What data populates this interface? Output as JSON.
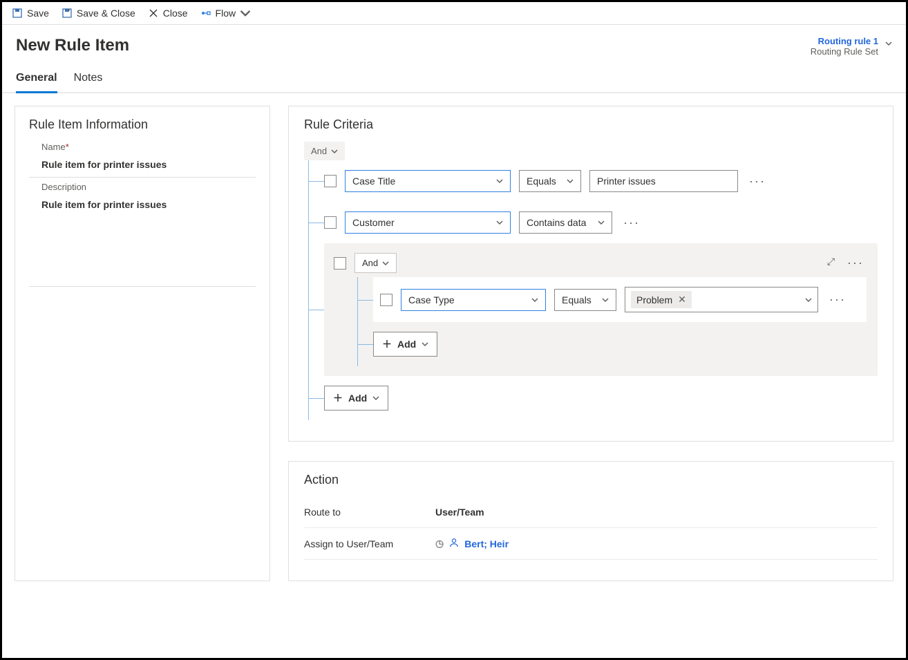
{
  "toolbar": {
    "save": "Save",
    "save_close": "Save & Close",
    "close": "Close",
    "flow": "Flow"
  },
  "header": {
    "title": "New Rule Item",
    "context_link": "Routing rule 1",
    "context_sub": "Routing Rule Set"
  },
  "tabs": {
    "general": "General",
    "notes": "Notes"
  },
  "info": {
    "section": "Rule Item Information",
    "name_label": "Name",
    "name_value": "Rule item for printer issues",
    "desc_label": "Description",
    "desc_value": "Rule item for printer issues"
  },
  "criteria": {
    "section": "Rule Criteria",
    "root_op": "And",
    "rows": [
      {
        "field": "Case Title",
        "op": "Equals",
        "value": "Printer issues"
      },
      {
        "field": "Customer",
        "op": "Contains data",
        "value": null
      }
    ],
    "group": {
      "op": "And",
      "rows": [
        {
          "field": "Case Type",
          "op": "Equals",
          "value_tag": "Problem"
        }
      ],
      "add": "Add"
    },
    "add": "Add"
  },
  "action": {
    "section": "Action",
    "route_to_label": "Route to",
    "route_to_value": "User/Team",
    "assign_label": "Assign to User/Team",
    "assign_value": "Bert; Heir"
  }
}
